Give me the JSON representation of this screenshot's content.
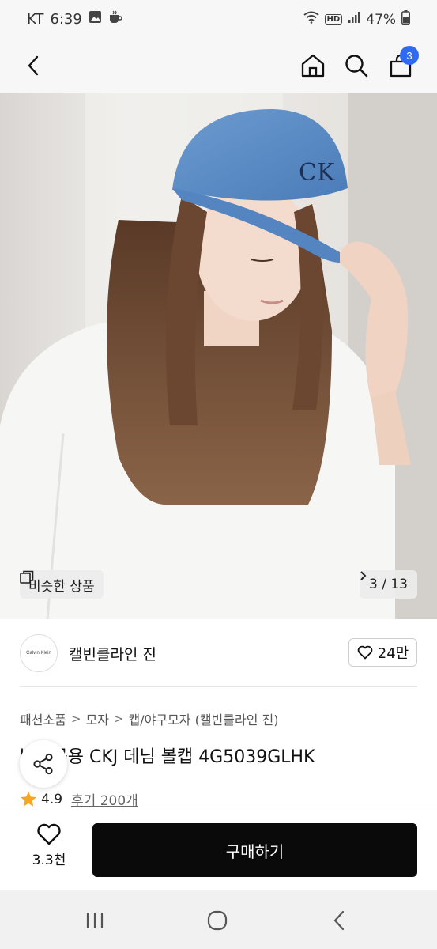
{
  "status_bar": {
    "carrier": "KT",
    "time": "6:39",
    "battery": "47%",
    "hd_label": "HD"
  },
  "nav": {
    "cart_count": "3"
  },
  "hero": {
    "similar_label": "비슷한 상품",
    "page_indicator": "3 / 13"
  },
  "brand": {
    "logo_text": "Calvin Klein",
    "name": "캘빈클라인 진",
    "likes": "24만"
  },
  "breadcrumb": {
    "items": [
      "패션소품",
      "모자",
      "캡/야구모자 (캘빈클라인 진)"
    ]
  },
  "product": {
    "title": "남녀공용 CKJ 데님 볼캡 4G5039GLHK",
    "rating": "4.9",
    "reviews": "후기 200개"
  },
  "bottom_bar": {
    "wish_count": "3.3천",
    "buy_label": "구매하기"
  },
  "colors": {
    "accent_blue": "#2f6bf2",
    "buy_button": "#0a0a0a",
    "star": "#f5a623"
  }
}
